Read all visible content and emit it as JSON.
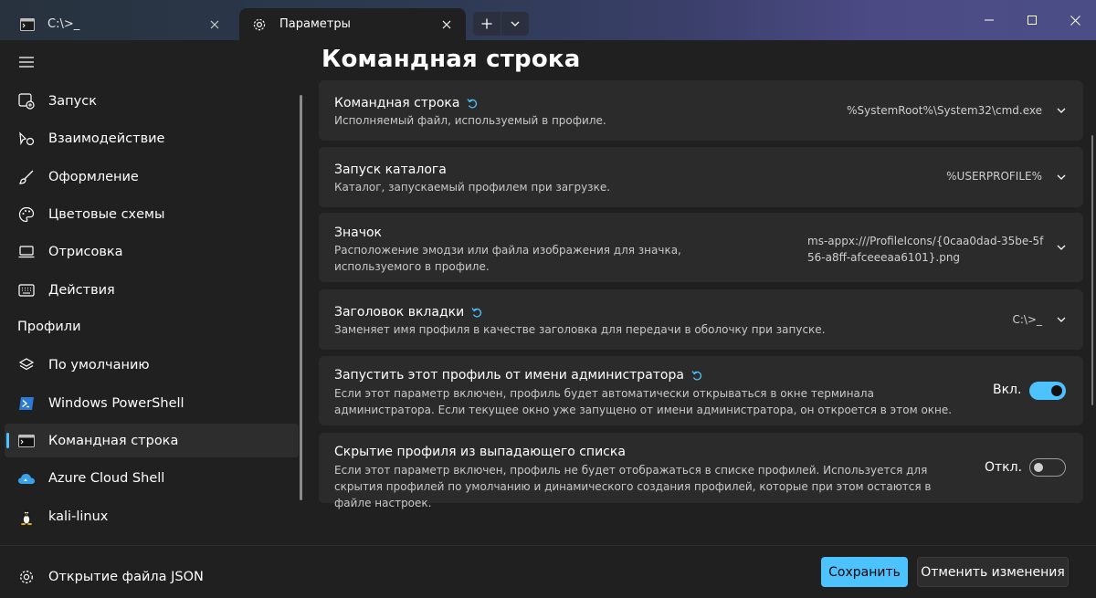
{
  "tabs": [
    {
      "title": "C:\\>_",
      "icon": "cmd-icon",
      "active": false
    },
    {
      "title": "Параметры",
      "icon": "gear-icon",
      "active": true
    }
  ],
  "sidebar": {
    "items": [
      {
        "label": "Запуск",
        "icon": "launch-icon"
      },
      {
        "label": "Взаимодействие",
        "icon": "interaction-icon"
      },
      {
        "label": "Оформление",
        "icon": "brush-icon"
      },
      {
        "label": "Цветовые схемы",
        "icon": "palette-icon"
      },
      {
        "label": "Отрисовка",
        "icon": "monitor-icon"
      },
      {
        "label": "Действия",
        "icon": "keyboard-icon"
      }
    ],
    "profiles_header": "Профили",
    "profiles": [
      {
        "label": "По умолчанию",
        "icon": "layers-icon"
      },
      {
        "label": "Windows PowerShell",
        "icon": "powershell-icon"
      },
      {
        "label": "Командная строка",
        "icon": "cmd-icon",
        "selected": true
      },
      {
        "label": "Azure Cloud Shell",
        "icon": "azure-icon"
      },
      {
        "label": "kali-linux",
        "icon": "linux-icon"
      }
    ],
    "open_json": {
      "label": "Открытие файла JSON",
      "icon": "gear-icon"
    }
  },
  "main": {
    "title": "Командная строка",
    "settings": [
      {
        "title": "Командная строка",
        "desc": "Исполняемый файл, используемый в профиле.",
        "value": "%SystemRoot%\\System32\\cmd.exe",
        "reset": true
      },
      {
        "title": "Запуск каталога",
        "desc": "Каталог, запускаемый профилем при загрузке.",
        "value": "%USERPROFILE%",
        "reset": false
      },
      {
        "title": "Значок",
        "desc": "Расположение эмодзи или файла изображения для значка, используемого в профиле.",
        "value": "ms-appx:///ProfileIcons/{0caa0dad-35be-5f56-a8ff-afceeeaa6101}.png",
        "reset": false
      },
      {
        "title": "Заголовок вкладки",
        "desc": "Заменяет имя профиля в качестве заголовка для передачи в оболочку при запуске.",
        "value": "C:\\>_",
        "reset": true
      },
      {
        "title": "Запустить этот профиль от имени администратора",
        "desc": "Если этот параметр включен, профиль будет автоматически открываться в окне терминала администратора. Если текущее окно уже запущено от имени администратора, он откроется в этом окне.",
        "toggle_label": "Вкл.",
        "toggle_on": true,
        "reset": true
      },
      {
        "title": "Скрытие профиля из выпадающего списка",
        "desc": "Если этот параметр включен, профиль не будет отображаться в списке профилей. Используется для скрытия профилей по умолчанию и динамического создания профилей, которые при этом остаются в файле настроек.",
        "toggle_label": "Откл.",
        "toggle_on": false,
        "reset": false
      }
    ]
  },
  "footer": {
    "save_label": "Сохранить",
    "discard_label": "Отменить изменения"
  },
  "colors": {
    "accent": "#4cc2ff",
    "background": "#202020",
    "card": "#2b2b2b"
  }
}
